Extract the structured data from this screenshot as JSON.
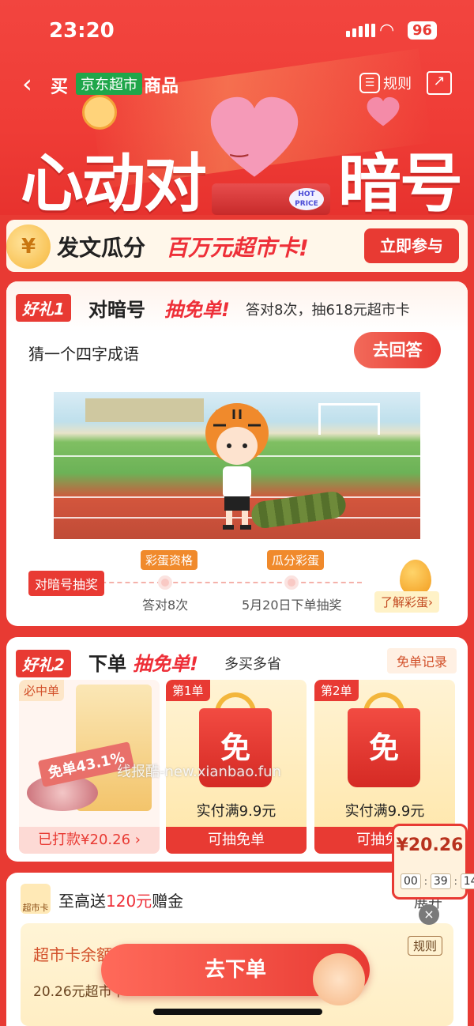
{
  "status": {
    "time": "23:20",
    "battery": "96"
  },
  "nav": {
    "back": "‹",
    "buy": "买",
    "jd_badge": "京东超市",
    "goods": "商品",
    "rules_label": "规则"
  },
  "hero": {
    "title_left": "心动对",
    "title_right": "暗号",
    "hot_price": "HOT PRICE"
  },
  "banner": {
    "text_black": "发文瓜分",
    "text_red": "百万元超市卡!",
    "button": "立即参与",
    "coin_symbol": "¥"
  },
  "gift1": {
    "tag": "好礼1",
    "title_black": "对暗号",
    "title_red": "抽免单!",
    "subtitle": "答对8次，抽618元超市卡",
    "question": "猜一个四字成语",
    "answer_button": "去回答",
    "timeline": {
      "start": "对暗号抽奖",
      "step1_tag": "彩蛋资格",
      "step1_label": "答对8次",
      "step2_tag": "瓜分彩蛋",
      "step2_label": "5月20日下单抽奖",
      "egg_button": "了解彩蛋›"
    }
  },
  "gift2": {
    "tag": "好礼2",
    "title_black": "下单",
    "title_red": "抽免单!",
    "subtitle": "多买多省",
    "record_button": "免单记录",
    "product": {
      "badge": "必中单",
      "stamp": "免单43.1%",
      "paid": "已打款¥20.26 ›"
    },
    "free_cards": [
      {
        "num": "第1单",
        "bag_text": "免",
        "condition": "实付满9.9元",
        "action": "可抽免单"
      },
      {
        "num": "第2单",
        "bag_text": "免",
        "condition": "实付满9.9元",
        "action": "可抽免单"
      }
    ]
  },
  "watermark": "线报酷-new.xianbao.fun",
  "card3": {
    "icon_label": "超市卡",
    "headline_prefix": "至高送",
    "headline_amount": "120元",
    "headline_suffix": "赠金",
    "expand": "展开",
    "balance_label": "超市卡余额",
    "rules": "规则",
    "balance_sub": "20.26元超市卡"
  },
  "timer": {
    "price": "¥20.26",
    "hh": "00",
    "mm": "39",
    "ss": "14"
  },
  "cta": {
    "label": "去下单"
  },
  "colors": {
    "brand_red": "#e83a33",
    "jd_green": "#1fa64a",
    "accent_orange": "#f08a2c"
  }
}
